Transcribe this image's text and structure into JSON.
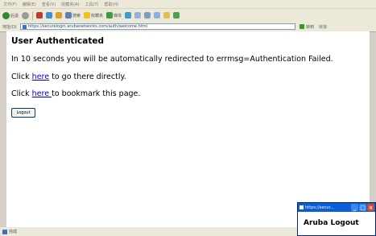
{
  "browser": {
    "menu": [
      "文件(F)",
      "编辑(E)",
      "查看(V)",
      "收藏夹(A)",
      "工具(T)",
      "帮助(H)"
    ],
    "toolbar": {
      "back_label": "后退",
      "search_label": "搜索",
      "favorites_label": "收藏夹",
      "media_label": "媒体"
    },
    "address": {
      "label": "地址(D)",
      "url": "https://securelogin.arubanetworks.com/auth/welcome.html",
      "go_label": "转到",
      "links_label": "链接"
    },
    "status": {
      "text": "完成"
    }
  },
  "page": {
    "title": "User Authenticated",
    "redirect_text": "In 10 seconds you will be automatically redirected to errmsg=Authentication Failed.",
    "line2_prefix": "Click ",
    "line2_link": "here",
    "line2_suffix": " to go there directly.",
    "line3_prefix": "Click ",
    "line3_link": "here ",
    "line3_suffix": "to bookmark this page.",
    "logout_button": "Logout"
  },
  "popup": {
    "title": "https://secur...",
    "body": "Aruba Logout"
  }
}
